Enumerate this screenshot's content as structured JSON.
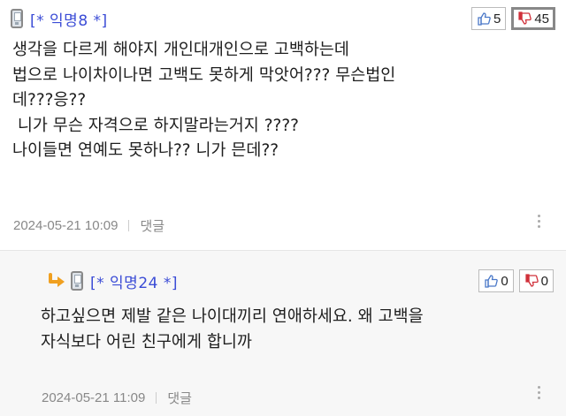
{
  "comments": [
    {
      "author": "[* 익명8 *]",
      "upvotes": "5",
      "downvotes": "45",
      "lines": [
        "생각을 다르게 해야지 개인대개인으로 고백하는데",
        "법으로 나이차이나면 고백도 못하게 막앗어??? 무슨법인",
        "데???응??",
        " 니가 무슨 자격으로 하지말라는거지 ????",
        "나이들면 연예도 못하나?? 니가 믄데??"
      ],
      "timestamp": "2024-05-21 10:09",
      "reply_label": "댓글"
    },
    {
      "author": "[* 익명24 *]",
      "upvotes": "0",
      "downvotes": "0",
      "lines": [
        "하고싶으면 제발 같은 나이대끼리 연애하세요. 왜 고백을",
        "자식보다 어린 친구에게 합니까"
      ],
      "timestamp": "2024-05-21 11:09",
      "reply_label": "댓글"
    }
  ],
  "icons": {
    "phone": "mobile-phone-icon",
    "thumb_up": "thumbs-up-icon",
    "thumb_down": "thumbs-down-icon",
    "more": "more-vertical-icon",
    "reply": "reply-arrow-icon"
  },
  "colors": {
    "author": "#3b4cd6",
    "reply_arrow": "#f0a020",
    "thumb_up": "#4a78c8",
    "thumb_down": "#d0303a"
  }
}
